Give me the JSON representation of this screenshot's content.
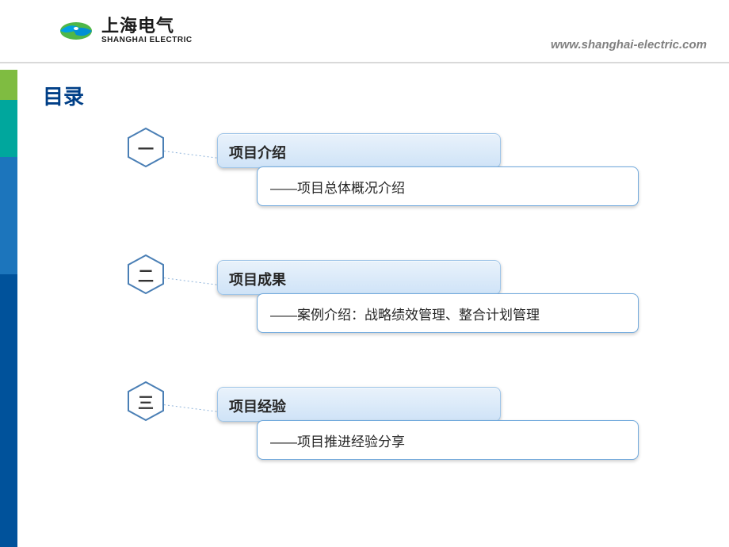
{
  "header": {
    "logo_cn": "上海电气",
    "logo_en": "SHANGHAI ELECTRIC",
    "url": "www.shanghai-electric.com"
  },
  "title": "目录",
  "sections": [
    {
      "num": "一",
      "heading": "项目介绍",
      "sub": "——项目总体概况介绍"
    },
    {
      "num": "二",
      "heading": "项目成果",
      "sub": "——案例介绍：战略绩效管理、整合计划管理"
    },
    {
      "num": "三",
      "heading": "项目经验",
      "sub": "——项目推进经验分享"
    }
  ]
}
